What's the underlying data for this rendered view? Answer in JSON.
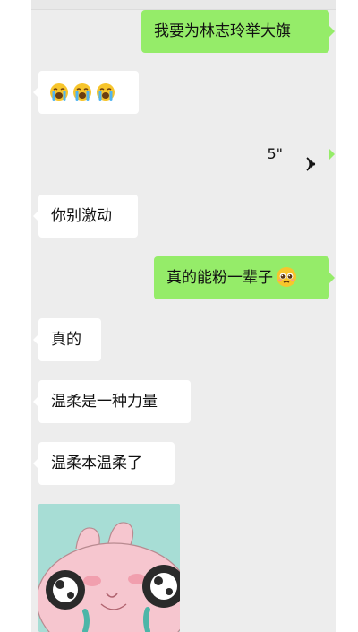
{
  "messages": [
    {
      "dir": "out",
      "type": "text",
      "text": "我要为林志玲举大旗"
    },
    {
      "dir": "in",
      "type": "emoji",
      "emojis": [
        "loudly-crying-face",
        "loudly-crying-face",
        "loudly-crying-face"
      ]
    },
    {
      "dir": "out",
      "type": "voice",
      "duration": "5\""
    },
    {
      "dir": "in",
      "type": "text",
      "text": "你别激动"
    },
    {
      "dir": "out",
      "type": "text",
      "text": "真的能粉一辈子",
      "emoji": "pleading-face"
    },
    {
      "dir": "in",
      "type": "text",
      "text": "真的"
    },
    {
      "dir": "in",
      "type": "text",
      "text": "温柔是一种力量"
    },
    {
      "dir": "in",
      "type": "text",
      "text": "温柔本温柔了"
    },
    {
      "dir": "in",
      "type": "sticker",
      "sticker": "pink-bunny-crying-sticker"
    }
  ],
  "colors": {
    "chat_bg": "#ededed",
    "outgoing_bubble": "#95ec69",
    "incoming_bubble": "#ffffff",
    "sticker_bg": "#a7ddd5",
    "sticker_face": "#f6c6cf"
  }
}
